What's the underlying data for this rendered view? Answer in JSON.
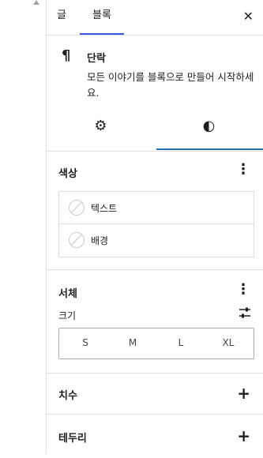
{
  "tabs": {
    "post": "글",
    "block": "블록"
  },
  "close_icon": "close-icon",
  "block": {
    "icon": "¶",
    "title": "단락",
    "description": "모든 이야기를 블록으로 만들어 시작하세요."
  },
  "subtabs": {
    "settings_icon": "gear-icon",
    "styles_icon": "contrast-icon"
  },
  "color": {
    "title": "색상",
    "items": [
      {
        "label": "텍스트"
      },
      {
        "label": "배경"
      }
    ]
  },
  "typography": {
    "title": "서체",
    "size_label": "크기",
    "sizes": [
      "S",
      "M",
      "L",
      "XL"
    ]
  },
  "dimensions": {
    "title": "치수"
  },
  "border": {
    "title": "테두리"
  },
  "colors": {
    "accent": "#3858e9",
    "styles_underline": "#2271b1"
  }
}
